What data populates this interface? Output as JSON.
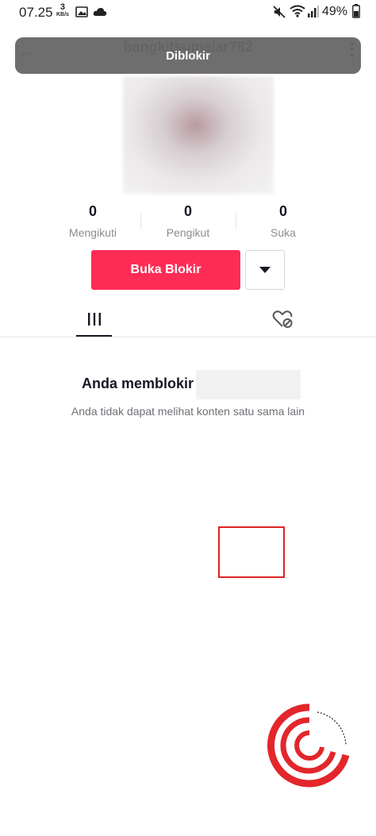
{
  "status_bar": {
    "time": "07.25",
    "net_speed_value": "3",
    "net_speed_unit": "KB/s",
    "battery": "49%",
    "icons": [
      "image-icon",
      "cloud-icon",
      "mute-icon",
      "wifi-icon",
      "signal-icon",
      "battery-icon"
    ]
  },
  "header": {
    "username": "bangkitsumelar782",
    "toast": "Diblokir"
  },
  "stats": [
    {
      "value": "0",
      "label": "Mengikuti"
    },
    {
      "value": "0",
      "label": "Pengikut"
    },
    {
      "value": "0",
      "label": "Suka"
    }
  ],
  "actions": {
    "unblock_label": "Buka Blokir"
  },
  "tabs": [
    "grid-icon",
    "liked-hidden-icon"
  ],
  "blocked": {
    "title": "Anda memblokir",
    "subtitle": "Anda tidak dapat melihat konten satu sama lain"
  },
  "colors": {
    "accent": "#fe2c55",
    "highlight": "#e02424"
  }
}
